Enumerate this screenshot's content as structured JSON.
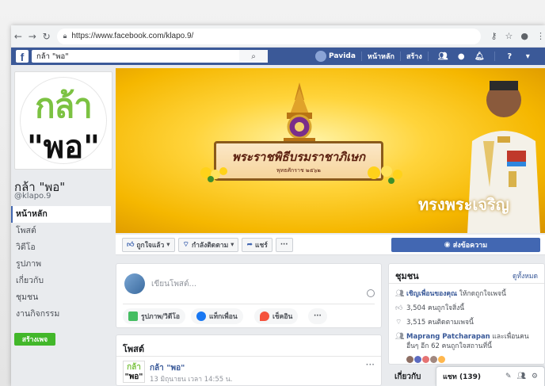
{
  "browser": {
    "url": "https://www.facebook.com/klapo.9/",
    "nav": [
      "back-icon",
      "forward-icon",
      "reload-icon"
    ]
  },
  "fb_top": {
    "search_value": "กล้า \"พอ\"",
    "user_name": "Pavida",
    "home": "หน้าหลัก",
    "create": "สร้าง",
    "brand_color": "#3b5998"
  },
  "profile": {
    "pic_line1": "กล้า",
    "pic_line2": "\"พอ\"",
    "name": "กล้า \"พอ\"",
    "handle": "@klapo.9"
  },
  "left_nav": {
    "items": [
      {
        "label": "หน้าหลัก",
        "active": true
      },
      {
        "label": "โพสต์",
        "active": false
      },
      {
        "label": "วิดีโอ",
        "active": false
      },
      {
        "label": "รูปภาพ",
        "active": false
      },
      {
        "label": "เกี่ยวกับ",
        "active": false
      },
      {
        "label": "ชุมชน",
        "active": false
      },
      {
        "label": "งานกิจกรรม",
        "active": false
      }
    ],
    "create_page": "สร้างเพจ"
  },
  "cover": {
    "banner_title": "พระราชพิธีบรมราชาภิเษก",
    "banner_sub": "พุทธศักราช ๒๕๖๒",
    "caption": "ทรงพระเจริญ"
  },
  "actions": {
    "liked": "ถูกใจแล้ว",
    "following": "กำลังติดตาม",
    "share": "แชร์",
    "more": "···",
    "message": "ส่งข้อความ"
  },
  "composer": {
    "placeholder": "เขียนโพสต์...",
    "photo_video": "รูปภาพ/วิดีโอ",
    "tag_friends": "แท็กเพื่อน",
    "check_in": "เช็คอิน",
    "more": "···"
  },
  "posts": {
    "title": "โพสต์",
    "first_post": {
      "author": "กล้า \"พอ\"",
      "time": "13 มิถุนายน เวลา 14:55 น."
    }
  },
  "community": {
    "title": "ชุมชน",
    "see_all": "ดูทั้งหมด",
    "invite_link": "เชิญเพื่อนของคุณ",
    "invite_rest": " ให้กดถูกใจเพจนี้",
    "likes": "3,504 คนถูกใจสิ่งนี้",
    "follows": "3,515 คนติดตามเพจนี้",
    "friends_link": "Maprang Patcharapan",
    "friends_rest": " และเพื่อนคนอื่นๆ อีก 62 คนถูกใจสถานที่นี้"
  },
  "chat": {
    "label": "แชท (139)",
    "peek": "เกี่ยวกับ"
  }
}
